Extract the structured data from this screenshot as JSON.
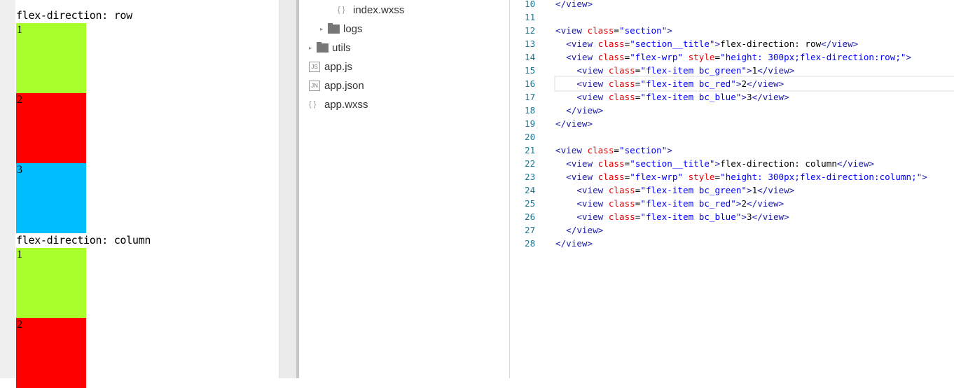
{
  "simulator": {
    "sections": [
      {
        "title": "flex-direction: row",
        "items": [
          {
            "label": "1",
            "color": "#a9ff2b"
          },
          {
            "label": "2",
            "color": "#ff0000"
          },
          {
            "label": "3",
            "color": "#00bfff"
          }
        ]
      },
      {
        "title": "flex-direction: column",
        "items": [
          {
            "label": "1",
            "color": "#a9ff2b"
          },
          {
            "label": "2",
            "color": "#ff0000"
          }
        ]
      }
    ]
  },
  "tree": [
    {
      "label": "index.wxss",
      "icon": "braces-icon",
      "kind": "file"
    },
    {
      "label": "logs",
      "icon": "folder-icon",
      "kind": "folder"
    },
    {
      "label": "utils",
      "icon": "folder-icon",
      "kind": "folder"
    },
    {
      "label": "app.js",
      "icon": "js-file-icon",
      "badge": "JS",
      "kind": "file"
    },
    {
      "label": "app.json",
      "icon": "json-file-icon",
      "badge": "JN",
      "kind": "file"
    },
    {
      "label": "app.wxss",
      "icon": "braces-icon",
      "kind": "file"
    }
  ],
  "editor": {
    "lines": [
      {
        "n": "10",
        "indent": 0,
        "tokens": [
          [
            "tag",
            "</view>"
          ]
        ]
      },
      {
        "n": "11",
        "indent": 0,
        "tokens": []
      },
      {
        "n": "12",
        "indent": 0,
        "tokens": [
          [
            "tag",
            "<view "
          ],
          [
            "attr",
            "class"
          ],
          [
            "text",
            "="
          ],
          [
            "val",
            "\"section\""
          ],
          [
            "tag",
            ">"
          ]
        ]
      },
      {
        "n": "13",
        "indent": 1,
        "tokens": [
          [
            "tag",
            "<view "
          ],
          [
            "attr",
            "class"
          ],
          [
            "text",
            "="
          ],
          [
            "val",
            "\"section__title\""
          ],
          [
            "tag",
            ">"
          ],
          [
            "text",
            "flex-direction: row"
          ],
          [
            "tag",
            "</view>"
          ]
        ]
      },
      {
        "n": "14",
        "indent": 1,
        "tokens": [
          [
            "tag",
            "<view "
          ],
          [
            "attr",
            "class"
          ],
          [
            "text",
            "="
          ],
          [
            "val",
            "\"flex-wrp\" "
          ],
          [
            "attr",
            "style"
          ],
          [
            "text",
            "="
          ],
          [
            "val",
            "\"height: 300px;flex-direction:row;\""
          ],
          [
            "tag",
            ">"
          ]
        ]
      },
      {
        "n": "15",
        "indent": 2,
        "tokens": [
          [
            "tag",
            "<view "
          ],
          [
            "attr",
            "class"
          ],
          [
            "text",
            "="
          ],
          [
            "val",
            "\"flex-item bc_green\""
          ],
          [
            "tag",
            ">"
          ],
          [
            "text",
            "1"
          ],
          [
            "tag",
            "</view>"
          ]
        ]
      },
      {
        "n": "16",
        "indent": 2,
        "current": true,
        "tokens": [
          [
            "tag",
            "<view "
          ],
          [
            "attr",
            "class"
          ],
          [
            "text",
            "="
          ],
          [
            "val",
            "\"flex-item bc_red\""
          ],
          [
            "tag",
            ">"
          ],
          [
            "text",
            "2"
          ],
          [
            "tag",
            "</view>"
          ]
        ]
      },
      {
        "n": "17",
        "indent": 2,
        "tokens": [
          [
            "tag",
            "<view "
          ],
          [
            "attr",
            "class"
          ],
          [
            "text",
            "="
          ],
          [
            "val",
            "\"flex-item bc_blue\""
          ],
          [
            "tag",
            ">"
          ],
          [
            "text",
            "3"
          ],
          [
            "tag",
            "</view>"
          ]
        ]
      },
      {
        "n": "18",
        "indent": 1,
        "tokens": [
          [
            "tag",
            "</view>"
          ]
        ]
      },
      {
        "n": "19",
        "indent": 0,
        "tokens": [
          [
            "tag",
            "</view>"
          ]
        ]
      },
      {
        "n": "20",
        "indent": 0,
        "tokens": []
      },
      {
        "n": "21",
        "indent": 0,
        "tokens": [
          [
            "tag",
            "<view "
          ],
          [
            "attr",
            "class"
          ],
          [
            "text",
            "="
          ],
          [
            "val",
            "\"section\""
          ],
          [
            "tag",
            ">"
          ]
        ]
      },
      {
        "n": "22",
        "indent": 1,
        "tokens": [
          [
            "tag",
            "<view "
          ],
          [
            "attr",
            "class"
          ],
          [
            "text",
            "="
          ],
          [
            "val",
            "\"section__title\""
          ],
          [
            "tag",
            ">"
          ],
          [
            "text",
            "flex-direction: column"
          ],
          [
            "tag",
            "</view>"
          ]
        ]
      },
      {
        "n": "23",
        "indent": 1,
        "tokens": [
          [
            "tag",
            "<view "
          ],
          [
            "attr",
            "class"
          ],
          [
            "text",
            "="
          ],
          [
            "val",
            "\"flex-wrp\" "
          ],
          [
            "attr",
            "style"
          ],
          [
            "text",
            "="
          ],
          [
            "val",
            "\"height: 300px;flex-direction:column;\""
          ],
          [
            "tag",
            ">"
          ]
        ]
      },
      {
        "n": "24",
        "indent": 2,
        "tokens": [
          [
            "tag",
            "<view "
          ],
          [
            "attr",
            "class"
          ],
          [
            "text",
            "="
          ],
          [
            "val",
            "\"flex-item bc_green\""
          ],
          [
            "tag",
            ">"
          ],
          [
            "text",
            "1"
          ],
          [
            "tag",
            "</view>"
          ]
        ]
      },
      {
        "n": "25",
        "indent": 2,
        "tokens": [
          [
            "tag",
            "<view "
          ],
          [
            "attr",
            "class"
          ],
          [
            "text",
            "="
          ],
          [
            "val",
            "\"flex-item bc_red\""
          ],
          [
            "tag",
            ">"
          ],
          [
            "text",
            "2"
          ],
          [
            "tag",
            "</view>"
          ]
        ]
      },
      {
        "n": "26",
        "indent": 2,
        "tokens": [
          [
            "tag",
            "<view "
          ],
          [
            "attr",
            "class"
          ],
          [
            "text",
            "="
          ],
          [
            "val",
            "\"flex-item bc_blue\""
          ],
          [
            "tag",
            ">"
          ],
          [
            "text",
            "3"
          ],
          [
            "tag",
            "</view>"
          ]
        ]
      },
      {
        "n": "27",
        "indent": 1,
        "tokens": [
          [
            "tag",
            "</view>"
          ]
        ]
      },
      {
        "n": "28",
        "indent": 0,
        "tokens": [
          [
            "tag",
            "</view>"
          ]
        ]
      }
    ]
  }
}
